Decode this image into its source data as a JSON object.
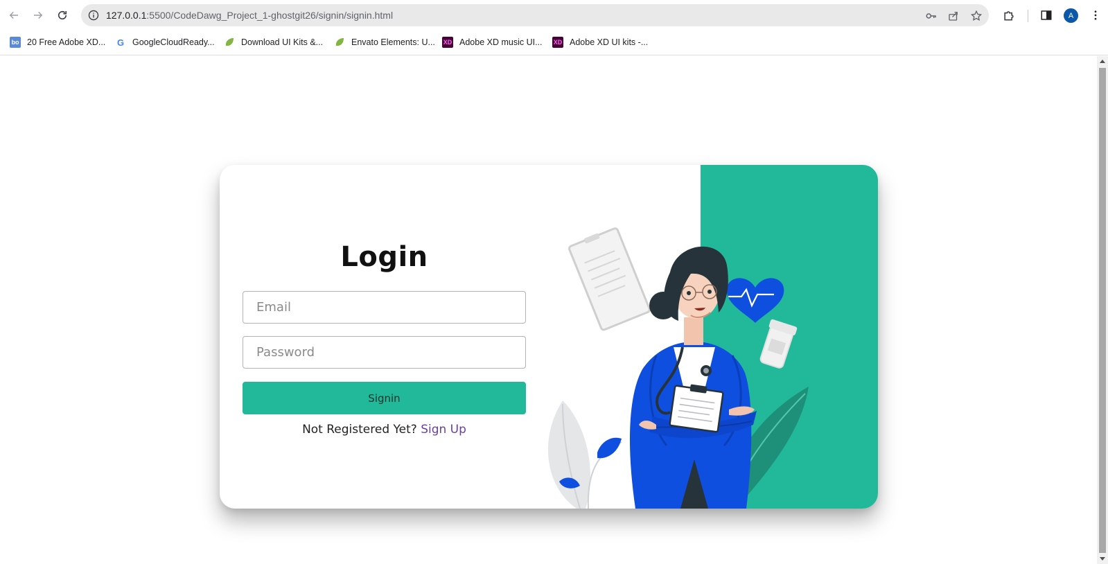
{
  "browser": {
    "url_host": "127.0.0.1",
    "url_rest": ":5500/CodeDawg_Project_1-ghostgit26/signin/signin.html",
    "avatar_letter": "A",
    "bookmarks": [
      {
        "label": "20 Free Adobe XD...",
        "icon": "bo-icon",
        "fav_text": "bo",
        "color": "#5a8ad6"
      },
      {
        "label": "GoogleCloudReady...",
        "icon": "google-icon",
        "fav_text": "G",
        "color": "#ffffff"
      },
      {
        "label": "Download UI Kits &...",
        "icon": "envato-leaf-icon",
        "fav_text": "",
        "color": "#82b541"
      },
      {
        "label": "Envato Elements: U...",
        "icon": "envato-leaf-icon",
        "fav_text": "",
        "color": "#82b541"
      },
      {
        "label": "Adobe XD music UI...",
        "icon": "adobe-xd-icon",
        "fav_text": "XD",
        "color": "#470137"
      },
      {
        "label": "Adobe XD UI kits -...",
        "icon": "adobe-xd-icon",
        "fav_text": "XD",
        "color": "#470137"
      }
    ]
  },
  "login": {
    "title": "Login",
    "email_placeholder": "Email",
    "password_placeholder": "Password",
    "signin_label": "Signin",
    "register_prompt": "Not Registered Yet?",
    "signup_link": "Sign Up"
  },
  "colors": {
    "accent": "#22b89a",
    "link": "#6a3ea1",
    "doctor_coat": "#0f4fe0"
  }
}
